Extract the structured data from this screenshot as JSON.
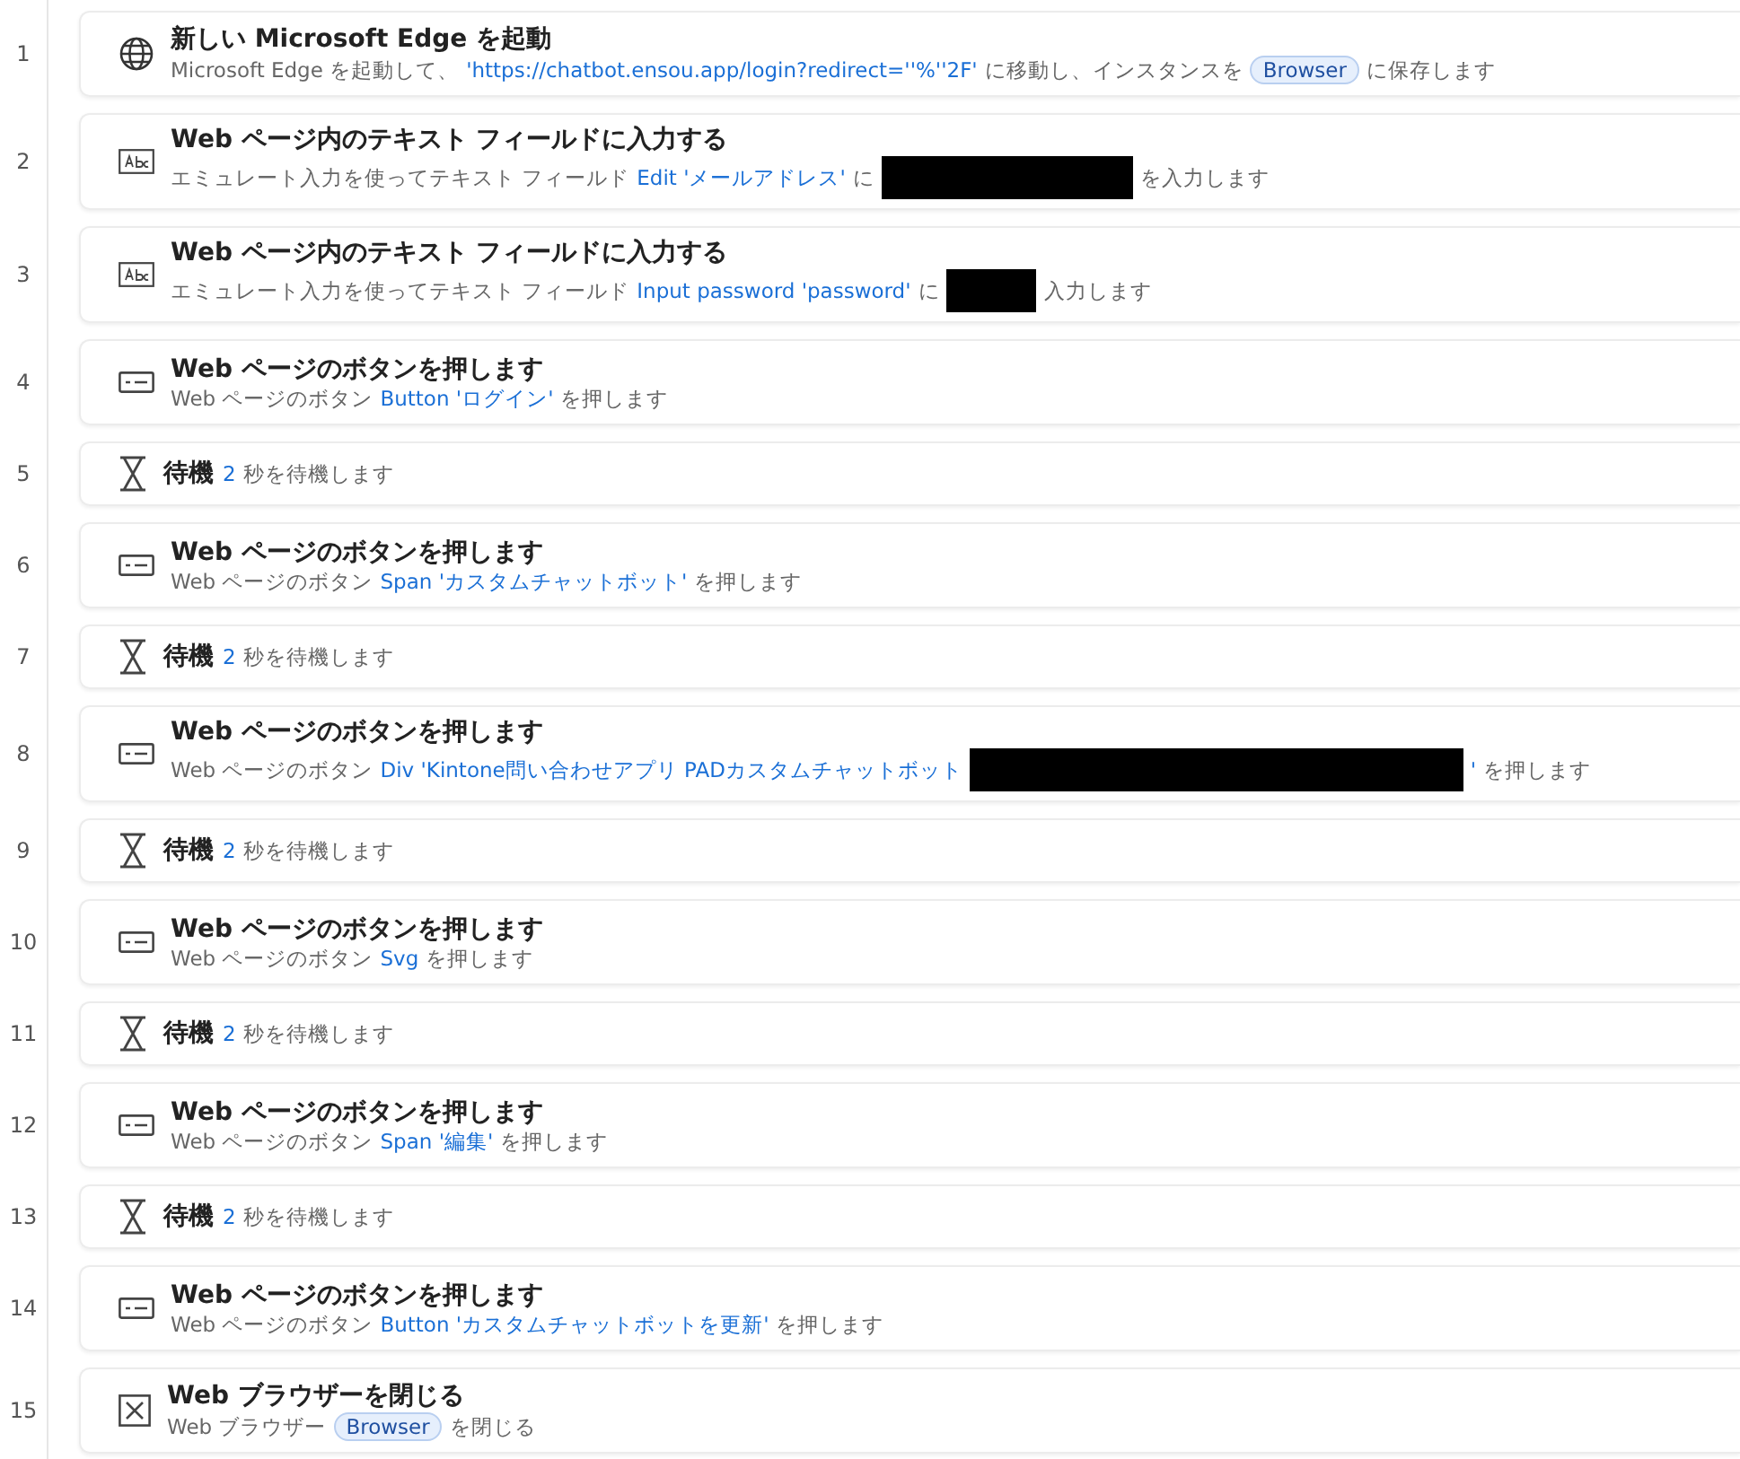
{
  "steps": [
    {
      "number": "1",
      "kind": "browser",
      "title": "新しい Microsoft Edge を起動",
      "detail": [
        {
          "kind": "text",
          "text": "Microsoft Edge を起動して、"
        },
        {
          "kind": "link",
          "text": "'https://chatbot.ensou.app/login?redirect=''%''2F'"
        },
        {
          "kind": "text",
          "text": "に移動し、インスタンスを"
        },
        {
          "kind": "var",
          "text": "Browser"
        },
        {
          "kind": "text",
          "text": "に保存します"
        }
      ]
    },
    {
      "number": "2",
      "kind": "input",
      "title": "Web ページ内のテキスト フィールドに入力する",
      "detail": [
        {
          "kind": "text",
          "text": "エミュレート入力を使ってテキスト フィールド"
        },
        {
          "kind": "link",
          "text": "Edit 'メールアドレス'"
        },
        {
          "kind": "text",
          "text": "に"
        },
        {
          "kind": "redacted_medium"
        },
        {
          "kind": "text",
          "text": "を入力します"
        }
      ]
    },
    {
      "number": "3",
      "kind": "input",
      "title": "Web ページ内のテキスト フィールドに入力する",
      "detail": [
        {
          "kind": "text",
          "text": "エミュレート入力を使ってテキスト フィールド"
        },
        {
          "kind": "link",
          "text": "Input password 'password'"
        },
        {
          "kind": "text",
          "text": "に"
        },
        {
          "kind": "redacted_small"
        },
        {
          "kind": "text",
          "text": "入力します"
        }
      ]
    },
    {
      "number": "4",
      "kind": "button",
      "title": "Web ページのボタンを押します",
      "detail": [
        {
          "kind": "text",
          "text": "Web ページのボタン"
        },
        {
          "kind": "link",
          "text": "Button 'ログイン'"
        },
        {
          "kind": "text",
          "text": "を押します"
        }
      ]
    },
    {
      "number": "5",
      "kind": "wait",
      "title": "待機",
      "detail": [
        {
          "kind": "link",
          "text": "2"
        },
        {
          "kind": "text",
          "text": "秒を待機します"
        }
      ]
    },
    {
      "number": "6",
      "kind": "button",
      "title": "Web ページのボタンを押します",
      "detail": [
        {
          "kind": "text",
          "text": "Web ページのボタン"
        },
        {
          "kind": "link",
          "text": "Span 'カスタムチャットボット'"
        },
        {
          "kind": "text",
          "text": "を押します"
        }
      ]
    },
    {
      "number": "7",
      "kind": "wait",
      "title": "待機",
      "detail": [
        {
          "kind": "link",
          "text": "2"
        },
        {
          "kind": "text",
          "text": "秒を待機します"
        }
      ]
    },
    {
      "number": "8",
      "kind": "button",
      "title": "Web ページのボタンを押します",
      "detail": [
        {
          "kind": "text",
          "text": "Web ページのボタン"
        },
        {
          "kind": "link",
          "text": "Div 'Kintone問い合わせアプリ PADカスタムチャットボット"
        },
        {
          "kind": "redacted_large"
        },
        {
          "kind": "link",
          "text": "'"
        },
        {
          "kind": "text",
          "text": "を押します"
        }
      ]
    },
    {
      "number": "9",
      "kind": "wait",
      "title": "待機",
      "detail": [
        {
          "kind": "link",
          "text": "2"
        },
        {
          "kind": "text",
          "text": "秒を待機します"
        }
      ]
    },
    {
      "number": "10",
      "kind": "button",
      "title": "Web ページのボタンを押します",
      "detail": [
        {
          "kind": "text",
          "text": "Web ページのボタン"
        },
        {
          "kind": "link",
          "text": "Svg"
        },
        {
          "kind": "text",
          "text": "を押します"
        }
      ]
    },
    {
      "number": "11",
      "kind": "wait",
      "title": "待機",
      "detail": [
        {
          "kind": "link",
          "text": "2"
        },
        {
          "kind": "text",
          "text": "秒を待機します"
        }
      ]
    },
    {
      "number": "12",
      "kind": "button",
      "title": "Web ページのボタンを押します",
      "detail": [
        {
          "kind": "text",
          "text": "Web ページのボタン"
        },
        {
          "kind": "link",
          "text": "Span '編集'"
        },
        {
          "kind": "text",
          "text": "を押します"
        }
      ]
    },
    {
      "number": "13",
      "kind": "wait",
      "title": "待機",
      "detail": [
        {
          "kind": "link",
          "text": "2"
        },
        {
          "kind": "text",
          "text": "秒を待機します"
        }
      ]
    },
    {
      "number": "14",
      "kind": "button",
      "title": "Web ページのボタンを押します",
      "detail": [
        {
          "kind": "text",
          "text": "Web ページのボタン"
        },
        {
          "kind": "link",
          "text": "Button 'カスタムチャットボットを更新'"
        },
        {
          "kind": "text",
          "text": "を押します"
        }
      ]
    },
    {
      "number": "15",
      "kind": "close",
      "title": "Web ブラウザーを閉じる",
      "detail": [
        {
          "kind": "text",
          "text": "Web ブラウザー"
        },
        {
          "kind": "var",
          "text": "Browser"
        },
        {
          "kind": "text",
          "text": "を閉じる"
        }
      ]
    }
  ]
}
